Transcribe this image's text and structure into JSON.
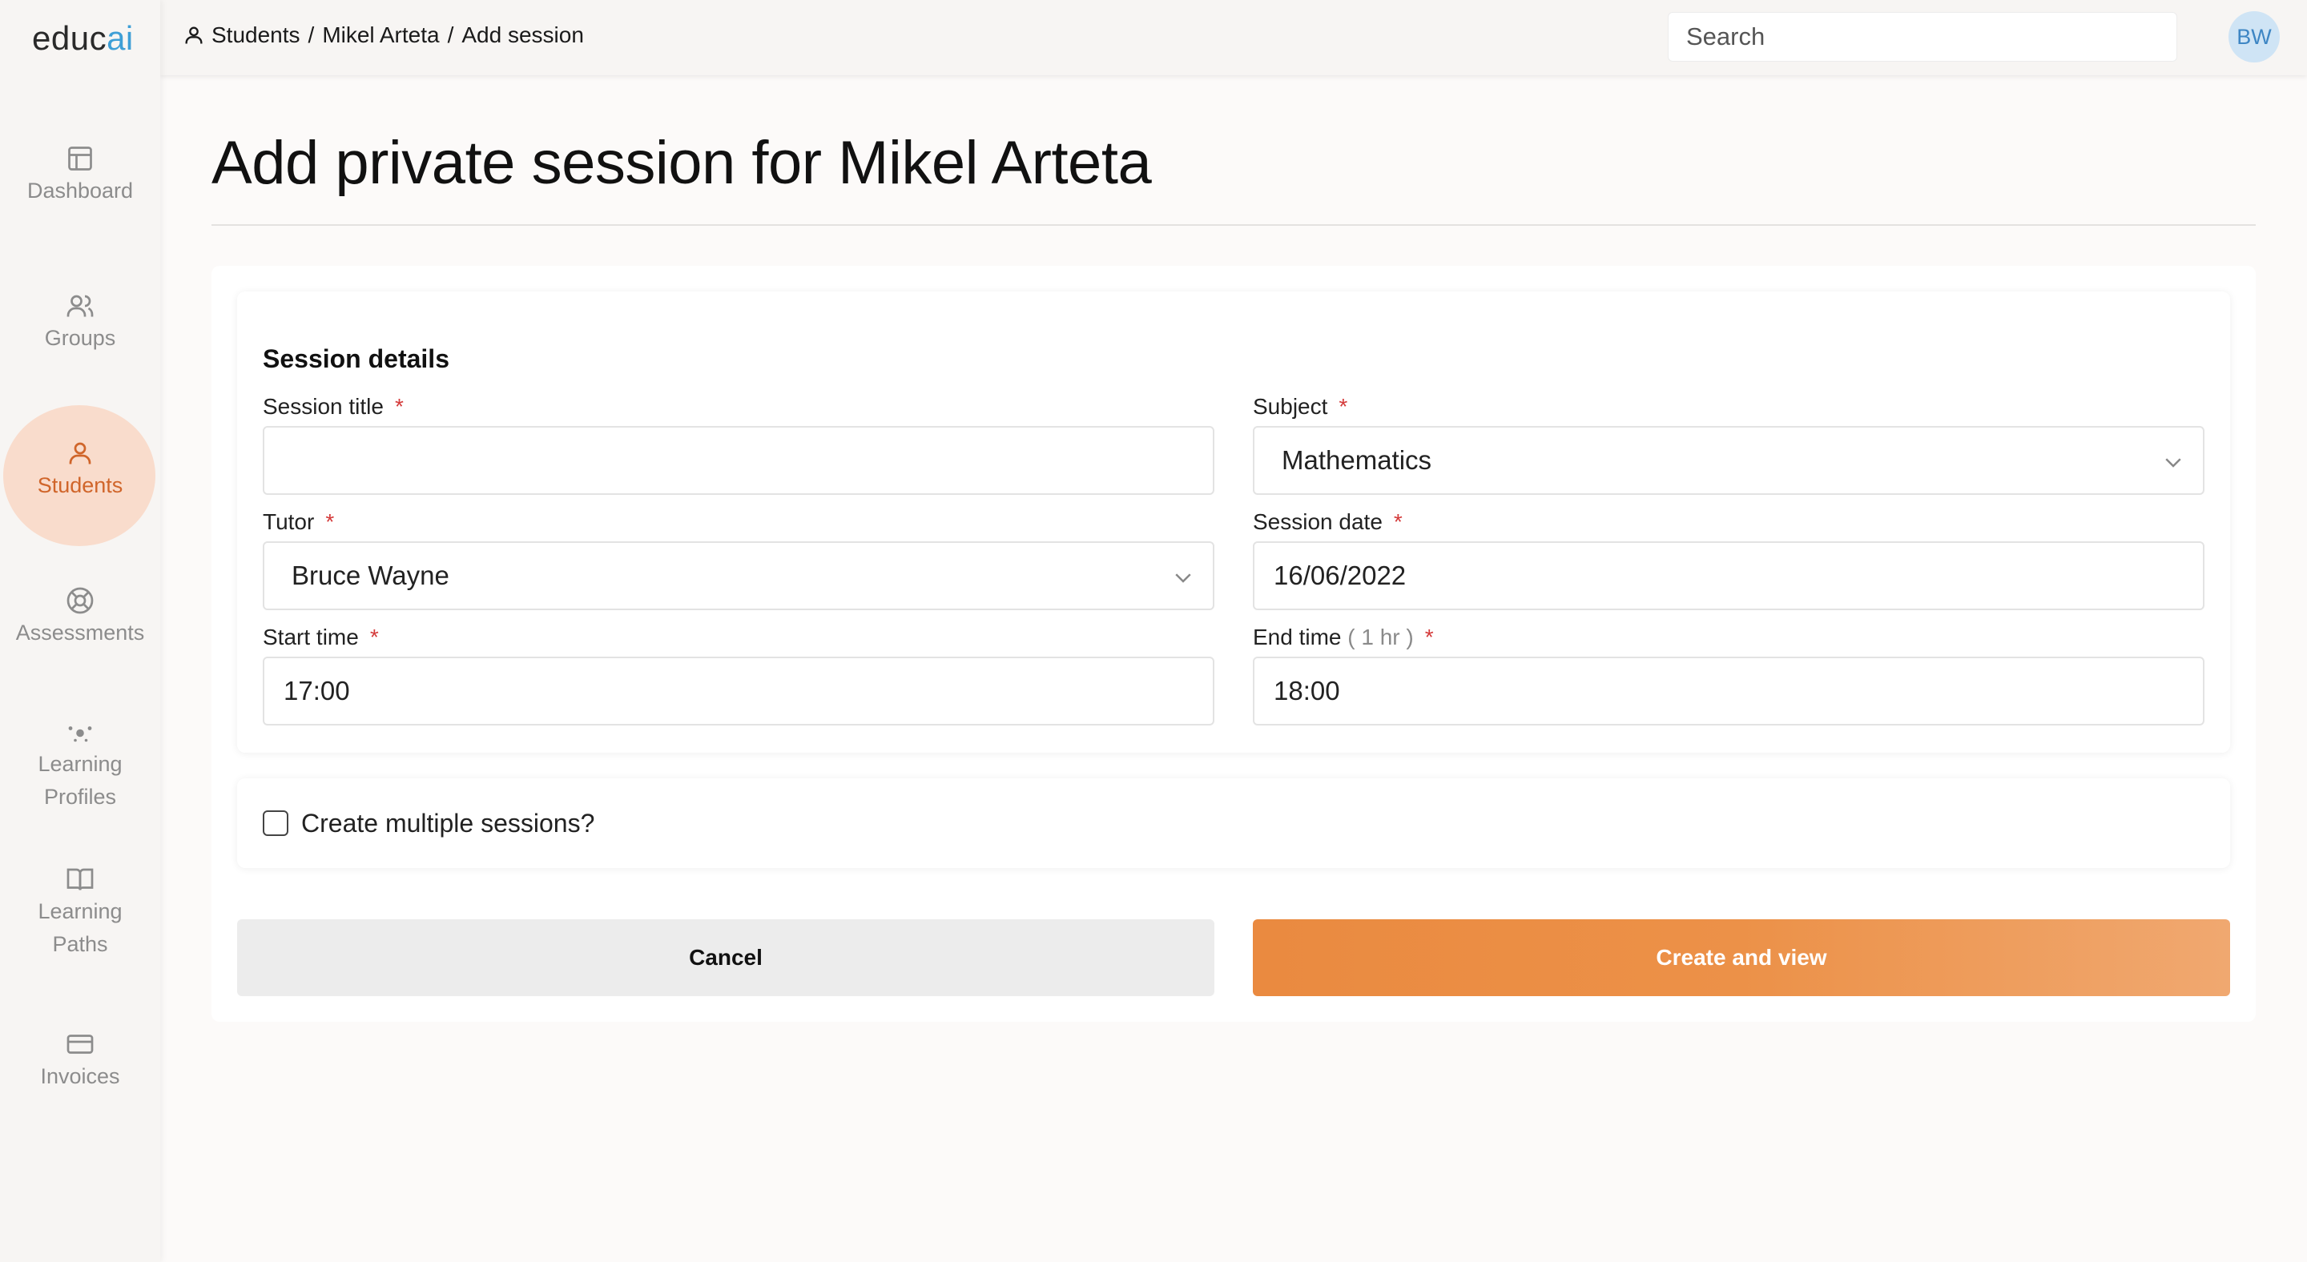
{
  "app": {
    "logo_main": "educ",
    "logo_accent": "ai",
    "accent_color": "#3e9fd6",
    "brand_color": "#ea8a40"
  },
  "sidebar": {
    "items": [
      {
        "label": "Dashboard",
        "icon": "dashboard-icon"
      },
      {
        "label": "Groups",
        "icon": "groups-icon"
      },
      {
        "label": "Students",
        "icon": "student-icon",
        "active": true
      },
      {
        "label": "Assessments",
        "icon": "lifebuoy-icon"
      },
      {
        "label_line1": "Learning",
        "label_line2": "Profiles",
        "icon": "dots-icon"
      },
      {
        "label_line1": "Learning",
        "label_line2": "Paths",
        "icon": "book-icon"
      },
      {
        "label": "Invoices",
        "icon": "card-icon"
      }
    ]
  },
  "header": {
    "breadcrumb": [
      "Students",
      "Mikel Arteta",
      "Add session"
    ],
    "breadcrumb_sep": "/",
    "search_placeholder": "Search",
    "avatar_initials": "BW"
  },
  "main": {
    "title": "Add private session for Mikel Arteta",
    "section_title": "Session details",
    "required_mark": "*",
    "fields": {
      "session_title": {
        "label": "Session title",
        "value": ""
      },
      "subject": {
        "label": "Subject",
        "value": "Mathematics"
      },
      "tutor": {
        "label": "Tutor",
        "value": "Bruce Wayne"
      },
      "session_date": {
        "label": "Session date",
        "value": "16/06/2022"
      },
      "start_time": {
        "label": "Start time",
        "value": "17:00"
      },
      "end_time": {
        "label": "End time",
        "hint": " ( 1 hr )",
        "value": "18:00"
      }
    },
    "multiple_sessions": {
      "label": "Create multiple sessions?",
      "checked": false
    },
    "buttons": {
      "cancel": "Cancel",
      "create": "Create and view"
    }
  }
}
